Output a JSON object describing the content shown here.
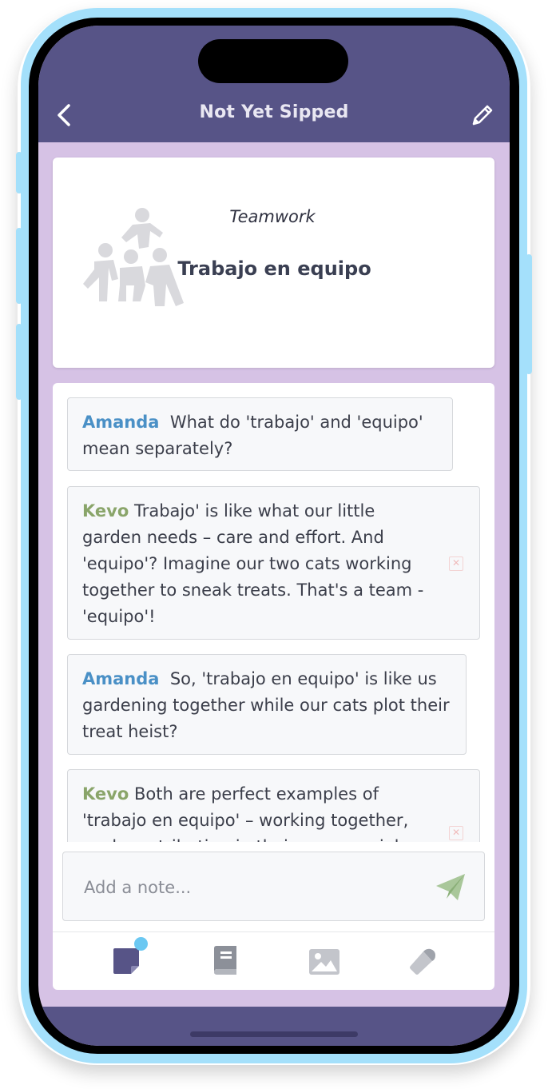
{
  "header": {
    "title": "Not Yet Sipped"
  },
  "word": {
    "english": "Teamwork",
    "spanish": "Trabajo en equipo"
  },
  "messages": [
    {
      "author": "Amanda",
      "text": "What do 'trabajo' and 'equipo' mean separately?"
    },
    {
      "author": "Kevo",
      "text": "Trabajo' is like what our little garden needs – care and effort. And 'equipo'? Imagine our two cats working together to sneak treats. That's a team - 'equipo'!"
    },
    {
      "author": "Amanda",
      "text": "So, 'trabajo en equipo' is like us gardening together while our cats plot their treat heist?"
    },
    {
      "author": "Kevo",
      "text": "Both are perfect examples of 'trabajo en equipo' – working together, each contributing in their own special way."
    }
  ],
  "note": {
    "placeholder": "Add a note..."
  },
  "colors": {
    "header": "#575487",
    "background": "#d6c2e5",
    "amanda": "#4a90c6",
    "kevo": "#8aa56a",
    "frame": "#a4e0fb"
  },
  "tabs": [
    {
      "icon": "notes-icon"
    },
    {
      "icon": "book-icon"
    },
    {
      "icon": "image-icon"
    },
    {
      "icon": "microphone-icon"
    }
  ]
}
